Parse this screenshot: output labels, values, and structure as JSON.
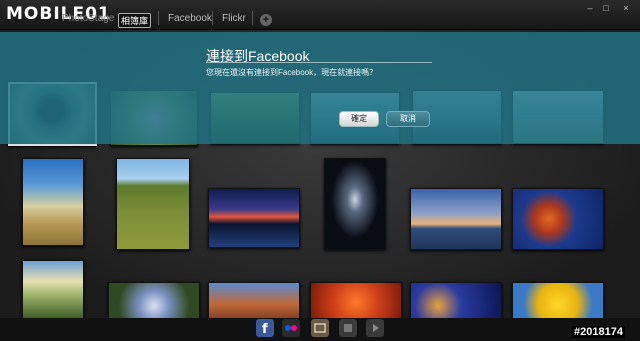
{
  "app": {
    "logo": "MOBILE01",
    "logo_sub": "相簿庫",
    "tabs": [
      {
        "label": "PhotoStage"
      },
      {
        "label": "Facebook"
      },
      {
        "label": "Flickr"
      }
    ],
    "add_tab": "+",
    "window_controls": {
      "minimize": "–",
      "maximize": "□",
      "close": "×"
    }
  },
  "dialog": {
    "title": "連接到Facebook",
    "message": "您現在還沒有連接到Facebook，現在就連接嗎？",
    "ok_label": "確定",
    "cancel_label": "取消"
  },
  "dock": {
    "icons": [
      "facebook-icon",
      "flickr-icon",
      "photo-icon",
      "grid-icon",
      "play-icon"
    ]
  },
  "watermark": "#2018174",
  "colors": {
    "dialog_overlay": "#227587",
    "facebook": "#3b5998",
    "flickr_pink": "#ff0084",
    "flickr_blue": "#0063dc"
  }
}
